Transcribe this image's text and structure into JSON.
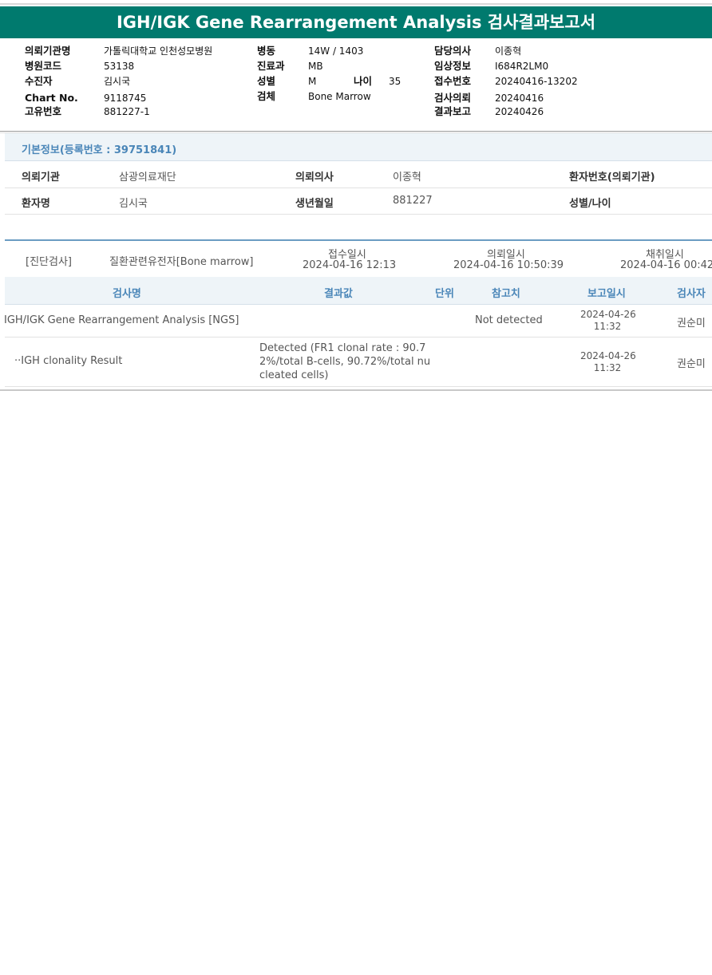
{
  "title": "IGH/IGK Gene Rearrangement Analysis 검사결과보고서",
  "header": {
    "col1": [
      {
        "label": "의뢰기관명",
        "value": "가톨릭대학교 인천성모병원"
      },
      {
        "label": "병원코드",
        "value": "53138"
      },
      {
        "label": "수진자",
        "value": "김시국"
      },
      {
        "label": "Chart No.",
        "value": "9118745"
      },
      {
        "label": "고유번호",
        "value": "881227-1"
      }
    ],
    "col2": [
      {
        "label": "병동",
        "value": "14W / 1403"
      },
      {
        "label": "진료과",
        "value": "MB"
      },
      {
        "label": "성별",
        "value": "M"
      },
      {
        "label": "검체",
        "value": "Bone Marrow"
      }
    ],
    "age_label": "나이",
    "age_value": "35",
    "col3": [
      {
        "label": "담당의사",
        "value": "이종혁"
      },
      {
        "label": "임상정보",
        "value": "I684R2LM0"
      },
      {
        "label": "접수번호",
        "value": "20240416-13202"
      },
      {
        "label": "검사의뢰",
        "value": "20240416"
      },
      {
        "label": "결과보고",
        "value": "20240426"
      }
    ]
  },
  "basic_info": {
    "section_title": "기본정보(등록번호 : 39751841)",
    "rows": [
      [
        {
          "label": "의뢰기관",
          "value": "삼광의료재단"
        },
        {
          "label": "의뢰의사",
          "value": "이종혁"
        },
        {
          "label": "환자번호(의뢰기관)",
          "value": ""
        }
      ],
      [
        {
          "label": "환자명",
          "value": "김시국"
        },
        {
          "label": "생년월일",
          "value": "881227"
        },
        {
          "label": "성별/나이",
          "value": ""
        }
      ]
    ]
  },
  "order": {
    "category": "[진단검사]",
    "specimen": "질환관련유전자[Bone marrow]",
    "received_label": "접수일시",
    "received": "2024-04-16 12:13",
    "requested_label": "의뢰일시",
    "requested": "2024-04-16 10:50:39",
    "collected_label": "채취일시",
    "collected": "2024-04-16 00:42"
  },
  "results_table": {
    "headers": [
      "검사명",
      "결과값",
      "단위",
      "참고치",
      "보고일시",
      "검사자"
    ],
    "rows": [
      {
        "name": "IGH/IGK Gene Rearrangement Analysis [NGS]",
        "result": [],
        "unit": "",
        "reference": "Not detected",
        "report_date": "2024-04-26",
        "report_time": "11:32",
        "tester": "권순미"
      },
      {
        "name": "··IGH clonality Result",
        "result": [
          "Detected (FR1 clonal rate : 90.7",
          "2%/total B-cells, 90.72%/total nu",
          "cleated cells)"
        ],
        "unit": "",
        "reference": "",
        "report_date": "2024-04-26",
        "report_time": "11:32",
        "tester": "권순미"
      }
    ]
  }
}
